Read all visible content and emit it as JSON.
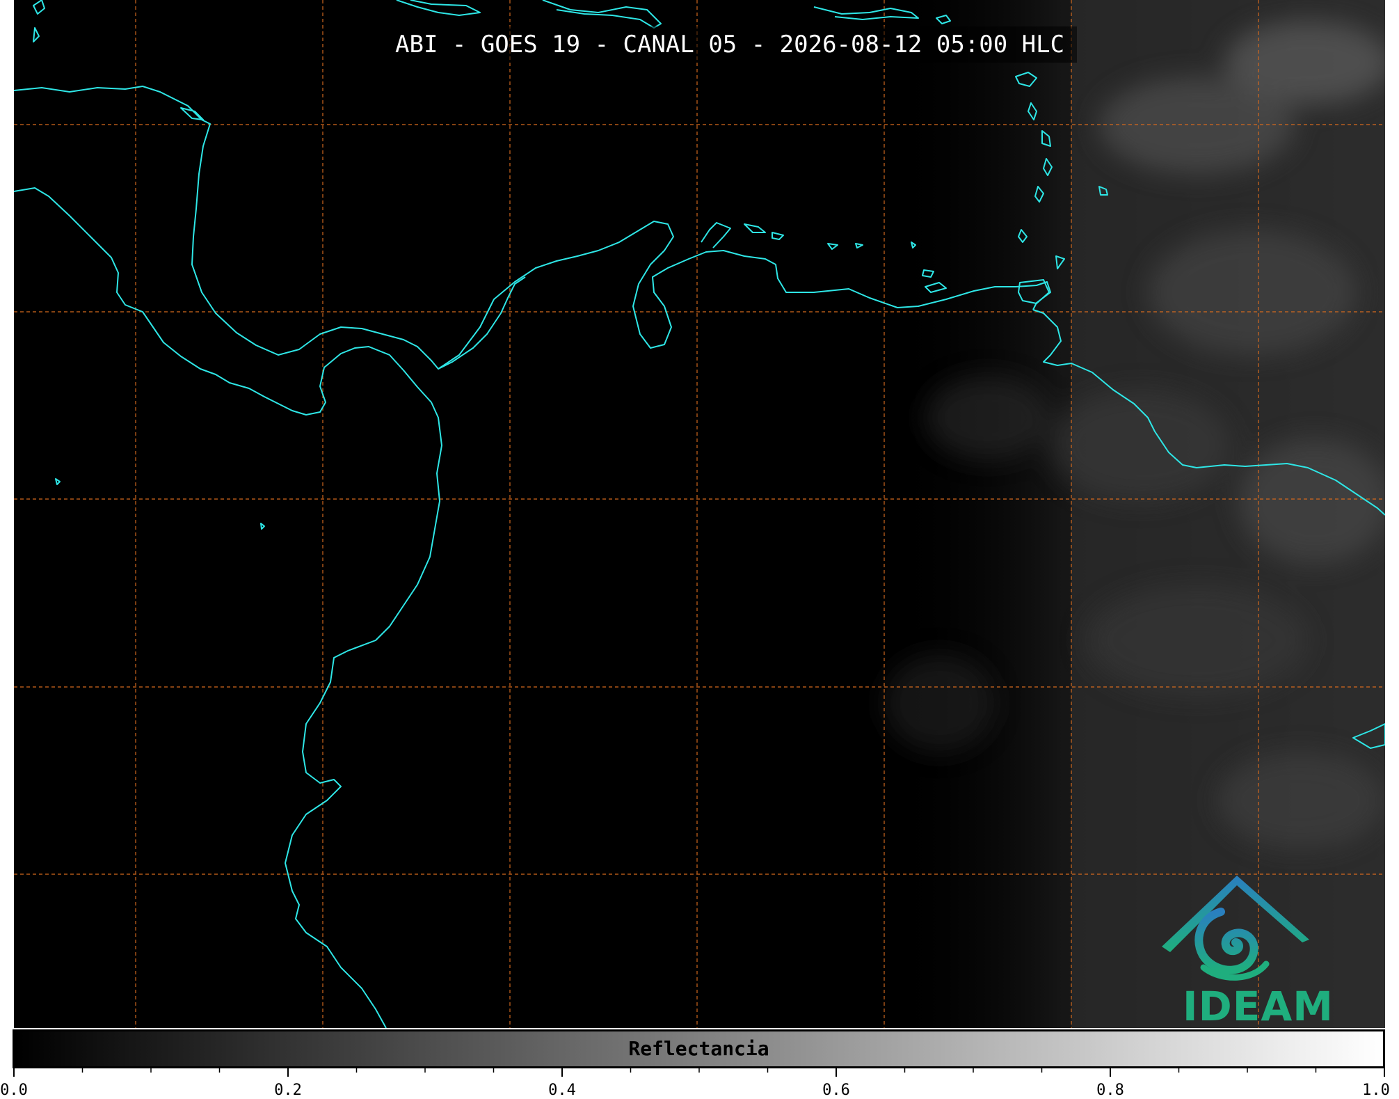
{
  "title": "ABI - GOES 19 - CANAL 05 - 2026-08-12 05:00 HLC",
  "colorbar": {
    "label": "Reflectancia",
    "range": [
      0.0,
      1.0
    ],
    "colors": [
      "#000000",
      "#ffffff"
    ],
    "major_ticks": [
      "0.0",
      "0.2",
      "0.4",
      "0.6",
      "0.8",
      "1.0"
    ]
  },
  "logo": {
    "text": "IDEAM",
    "icon": "ideam-mountain-swirl-icon",
    "colors": [
      "#2a7fc0",
      "#1fae7e"
    ]
  },
  "map": {
    "coastline_color": "#2ee6e6",
    "gridline_color": "#d2691e",
    "gridline_style": "dashed",
    "background": "#000000"
  }
}
